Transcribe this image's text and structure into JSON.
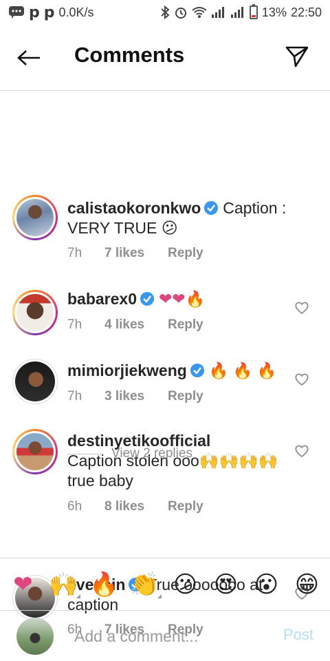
{
  "status_bar": {
    "net_speed": "0.0K/s",
    "battery": "13%",
    "time": "22:50"
  },
  "header": {
    "title": "Comments"
  },
  "comments": [
    {
      "username": "calistaokoronkwo",
      "verified": true,
      "text": "Caption : VERY TRUE 😕",
      "time": "7h",
      "likes": "7 likes",
      "reply": "Reply"
    },
    {
      "username": "babarex0",
      "verified": true,
      "text": "❤❤🔥",
      "time": "7h",
      "likes": "4 likes",
      "reply": "Reply"
    },
    {
      "username": "mimiorjiekweng",
      "verified": true,
      "text": "🔥 🔥 🔥",
      "time": "7h",
      "likes": "3 likes",
      "reply": "Reply"
    },
    {
      "username": "destinyetikoofficial",
      "verified": false,
      "text": "Caption stolen ooo🙌🙌🙌🙌 true baby",
      "time": "6h",
      "likes": "8 likes",
      "reply": "Reply"
    },
    {
      "username": "eveesin",
      "verified": true,
      "text": "True ooooooo at caption",
      "time": "6h",
      "likes": "7 likes",
      "reply": "Reply"
    }
  ],
  "view_replies": "View 2 replies",
  "emoji_bar": [
    "❤",
    "🙌",
    "🔥",
    "👏",
    "😕",
    "😍",
    "😮",
    "😁"
  ],
  "composer": {
    "placeholder": "Add a comment...",
    "post_label": "Post"
  },
  "colors": {
    "verified": "#3897f0",
    "post_disabled": "#b2dffc",
    "meta": "#8e8e8e"
  }
}
